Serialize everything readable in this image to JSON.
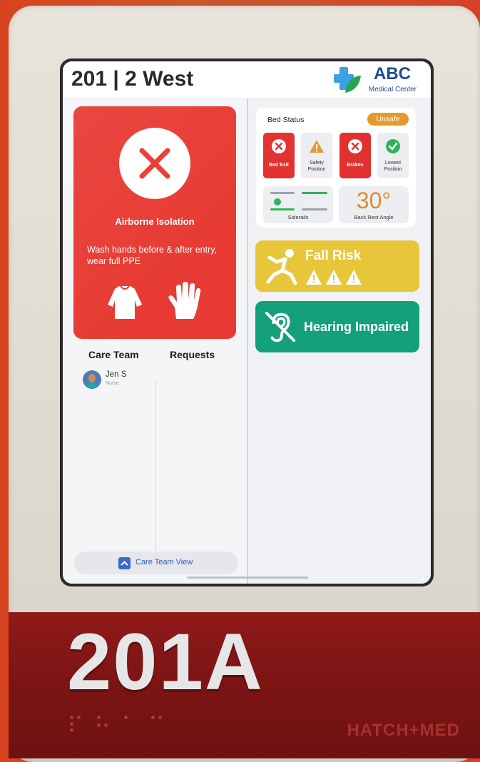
{
  "header": {
    "room": "201 | 2 West",
    "logo_name": "ABC",
    "logo_sub": "Medical Center"
  },
  "isolation": {
    "title": "Airborne Isolation",
    "instructions": "Wash hands before & after entry, wear full PPE"
  },
  "columns": {
    "care_team": "Care Team",
    "requests": "Requests"
  },
  "care_team": [
    {
      "name": "Jen S",
      "role": "Nurse"
    }
  ],
  "footer": {
    "care_team_view": "Care Team View"
  },
  "bed_status": {
    "title": "Bed Status",
    "status": "Unsafe",
    "tiles": [
      {
        "label": "Bed Exit",
        "state": "alert"
      },
      {
        "label": "Safety Position",
        "state": "warning"
      },
      {
        "label": "Brakes",
        "state": "alert"
      },
      {
        "label": "Lowest Position",
        "state": "ok"
      }
    ],
    "siderails_label": "Siderails",
    "back_rest_value": "30°",
    "back_rest_label": "Back Rest Angle"
  },
  "alerts": {
    "fall_risk": "Fall Risk",
    "hearing": "Hearing Impaired"
  },
  "plate": {
    "number": "201A",
    "brand": "HATCH+MED"
  },
  "colors": {
    "alert_red": "#e73a32",
    "warning_orange": "#e69a2a",
    "fall_yellow": "#e8c63a",
    "hearing_green": "#13a07a",
    "brand_blue": "#1d4b8e"
  }
}
